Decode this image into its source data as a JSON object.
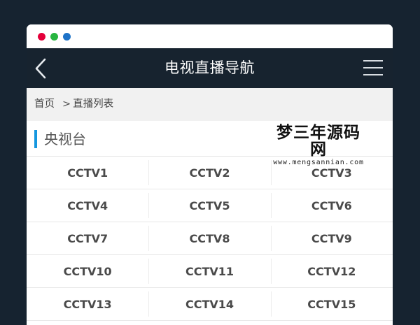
{
  "header": {
    "title": "电视直播导航"
  },
  "breadcrumb": {
    "home": "首页",
    "separator": ">",
    "current": "直播列表"
  },
  "section": {
    "title": "央视台"
  },
  "watermark": {
    "cn": "梦三年源码网",
    "en": "www.mengsannian.com"
  },
  "channels": [
    [
      "CCTV1",
      "CCTV2",
      "CCTV3"
    ],
    [
      "CCTV4",
      "CCTV5",
      "CCTV6"
    ],
    [
      "CCTV7",
      "CCTV8",
      "CCTV9"
    ],
    [
      "CCTV10",
      "CCTV11",
      "CCTV12"
    ],
    [
      "CCTV13",
      "CCTV14",
      "CCTV15"
    ]
  ],
  "colors": {
    "page_background": "#162330",
    "header_background": "#17232f",
    "accent_bar": "#1597df",
    "breadcrumb_background": "#f1f1f1",
    "window_dot_red": "#e4003a",
    "window_dot_green": "#27b540",
    "window_dot_blue": "#1e73c8"
  },
  "icons": {
    "back": "chevron-left-icon",
    "menu": "hamburger-menu-icon"
  }
}
